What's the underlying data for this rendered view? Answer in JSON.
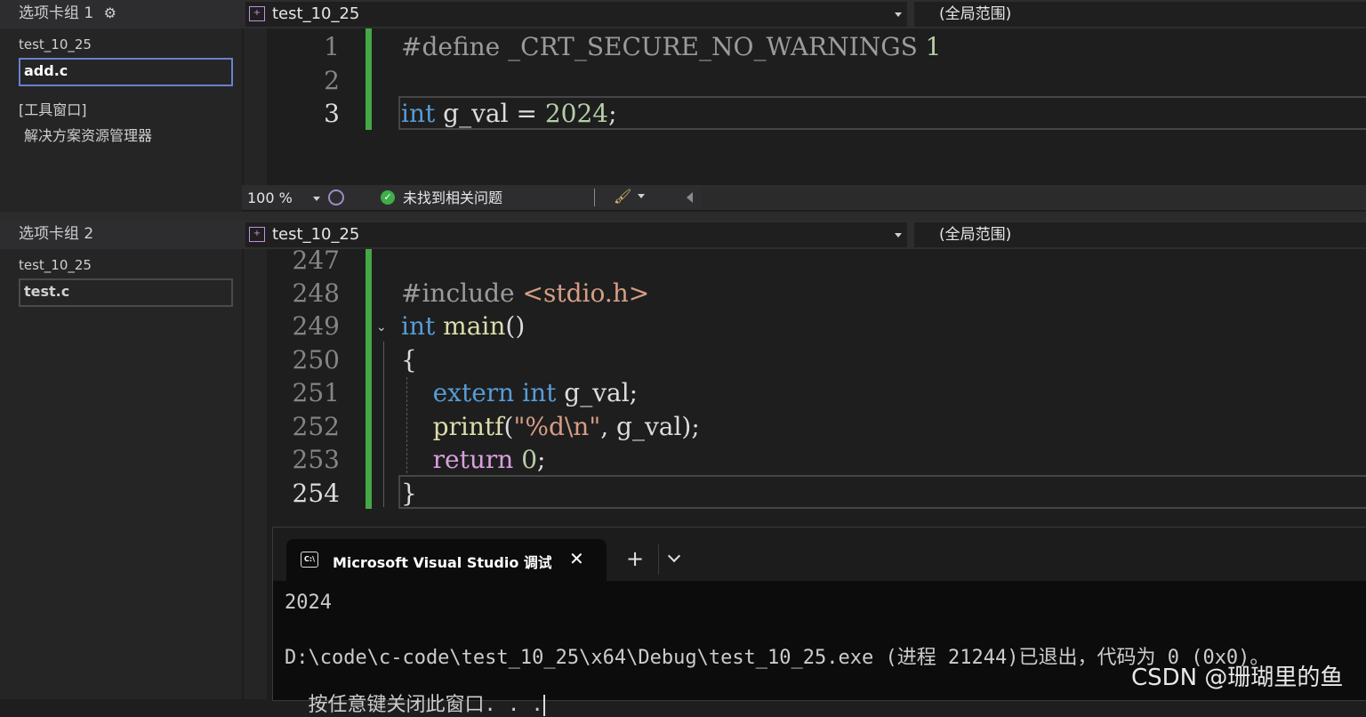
{
  "group1": {
    "header": "选项卡组 1",
    "project": "test_10_25",
    "file": "add.c",
    "tool_window_label": "[工具窗口]",
    "solution_explorer": "解决方案资源管理器"
  },
  "group2": {
    "header": "选项卡组 2",
    "project": "test_10_25",
    "file": "test.c"
  },
  "editor1": {
    "nav_project": "test_10_25",
    "nav_scope": "(全局范围)",
    "lines": [
      {
        "num": "1",
        "text": "#define _CRT_SECURE_NO_WARNINGS 1"
      },
      {
        "num": "2",
        "text": ""
      },
      {
        "num": "3",
        "text": "int g_val = 2024;"
      }
    ]
  },
  "status": {
    "zoom": "100 %",
    "issues": "未找到相关问题"
  },
  "editor2": {
    "nav_project": "test_10_25",
    "nav_scope": "(全局范围)",
    "lines": [
      {
        "num": "247",
        "text": ""
      },
      {
        "num": "248",
        "text": "#include <stdio.h>"
      },
      {
        "num": "249",
        "text": "int main()"
      },
      {
        "num": "250",
        "text": "{"
      },
      {
        "num": "251",
        "text": "    extern int g_val;"
      },
      {
        "num": "252",
        "text": "    printf(\"%d\\n\", g_val);"
      },
      {
        "num": "253",
        "text": "    return 0;"
      },
      {
        "num": "254",
        "text": "}"
      }
    ]
  },
  "terminal": {
    "tab_title": "Microsoft Visual Studio 调试控",
    "output_value": "2024",
    "exit_message": "D:\\code\\c-code\\test_10_25\\x64\\Debug\\test_10_25.exe (进程 21244)已退出，代码为 0 (0x0)。",
    "press_key": "按任意键关闭此窗口. . ."
  },
  "watermark": "CSDN @珊瑚里的鱼",
  "icons": {
    "settings": "gear-icon",
    "file_nav": "c-file-icon",
    "health": "brain-icon",
    "ok": "check-circle-icon",
    "cleanup": "brush-icon",
    "terminal": "console-icon",
    "close": "close-icon",
    "new_tab": "plus-icon",
    "dropdown": "chevron-down-icon"
  },
  "colors": {
    "keyword": "#569cd6",
    "function": "#dcdcaa",
    "number": "#b5cea8",
    "string": "#d69d85",
    "change_bar": "#45a847",
    "selection_border": "#6b7fcf"
  }
}
